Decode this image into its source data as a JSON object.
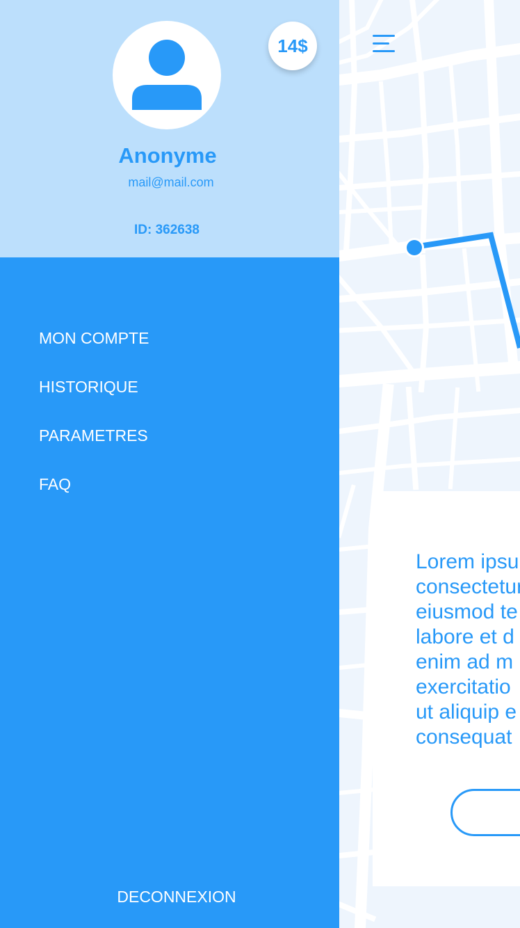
{
  "profile": {
    "name": "Anonyme",
    "email": "mail@mail.com",
    "id_label": "ID: 362638",
    "balance": "14$"
  },
  "menu": {
    "items": [
      {
        "label": "MON COMPTE"
      },
      {
        "label": "HISTORIQUE"
      },
      {
        "label": "PARAMETRES"
      },
      {
        "label": "FAQ"
      }
    ],
    "logout_label": "DECONNEXION"
  },
  "card": {
    "text": "Lorem ipsum\nconsectetur\neiusmod te\nlabore et d\nenim ad m\nexercitatio\nut aliquip e\nconsequat"
  },
  "colors": {
    "primary": "#2899f8",
    "header_bg": "#bcdffc",
    "map_bg": "#eef5fd",
    "white": "#ffffff"
  },
  "icons": {
    "avatar": "user-icon",
    "menu": "hamburger-icon",
    "route_start": "route-dot-icon"
  }
}
